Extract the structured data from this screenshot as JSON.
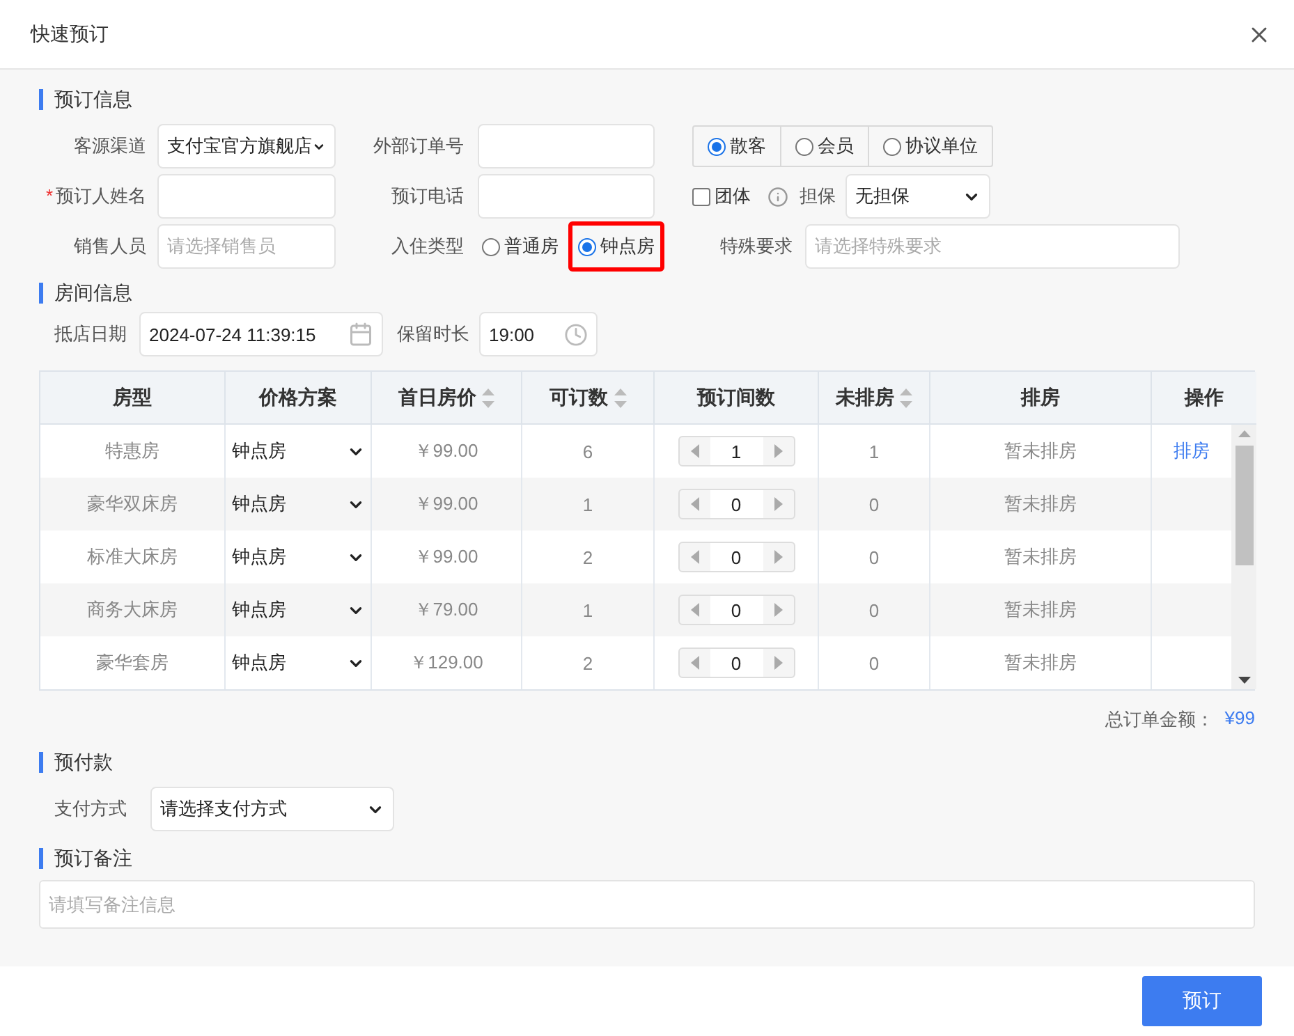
{
  "dialog": {
    "title": "快速预订"
  },
  "booking_info": {
    "title": "预订信息",
    "source_channel": {
      "label": "客源渠道",
      "value": "支付宝官方旗舰店"
    },
    "external_order": {
      "label": "外部订单号"
    },
    "customer_types": [
      {
        "label": "散客",
        "selected": true
      },
      {
        "label": "会员",
        "selected": false
      },
      {
        "label": "协议单位",
        "selected": false
      }
    ],
    "booker_name": {
      "label": "预订人姓名",
      "required_mark": "*"
    },
    "phone": {
      "label": "预订电话"
    },
    "group": {
      "label": "团体",
      "checked": false
    },
    "guarantee": {
      "label": "担保",
      "value": "无担保"
    },
    "sales": {
      "label": "销售人员",
      "placeholder": "请选择销售员"
    },
    "checkin_type": {
      "label": "入住类型",
      "options": [
        {
          "label": "普通房",
          "selected": false,
          "highlighted": false
        },
        {
          "label": "钟点房",
          "selected": true,
          "highlighted": true
        }
      ]
    },
    "special": {
      "label": "特殊要求",
      "placeholder": "请选择特殊要求"
    }
  },
  "room_info": {
    "title": "房间信息",
    "arrival": {
      "label": "抵店日期",
      "value": "2024-07-24 11:39:15"
    },
    "hold": {
      "label": "保留时长",
      "value": "19:00"
    }
  },
  "table": {
    "columns": [
      {
        "label": "房型",
        "sortable": false
      },
      {
        "label": "价格方案",
        "sortable": false
      },
      {
        "label": "首日房价",
        "sortable": true
      },
      {
        "label": "可订数",
        "sortable": true
      },
      {
        "label": "预订间数",
        "sortable": false
      },
      {
        "label": "未排房",
        "sortable": true
      },
      {
        "label": "排房",
        "sortable": false
      },
      {
        "label": "操作",
        "sortable": false
      }
    ],
    "rows": [
      {
        "room_type": "特惠房",
        "plan": "钟点房",
        "price": "￥99.00",
        "available": "6",
        "count": "1",
        "unassigned": "1",
        "assignment": "暂未排房",
        "action": "排房"
      },
      {
        "room_type": "豪华双床房",
        "plan": "钟点房",
        "price": "￥99.00",
        "available": "1",
        "count": "0",
        "unassigned": "0",
        "assignment": "暂未排房"
      },
      {
        "room_type": "标准大床房",
        "plan": "钟点房",
        "price": "￥99.00",
        "available": "2",
        "count": "0",
        "unassigned": "0",
        "assignment": "暂未排房"
      },
      {
        "room_type": "商务大床房",
        "plan": "钟点房",
        "price": "￥79.00",
        "available": "1",
        "count": "0",
        "unassigned": "0",
        "assignment": "暂未排房"
      },
      {
        "room_type": "豪华套房",
        "plan": "钟点房",
        "price": "￥129.00",
        "available": "2",
        "count": "0",
        "unassigned": "0",
        "assignment": "暂未排房"
      }
    ]
  },
  "total": {
    "label": "总订单金额：",
    "value": "¥99"
  },
  "prepay": {
    "title": "预付款",
    "method": {
      "label": "支付方式",
      "value": "请选择支付方式"
    }
  },
  "remarks": {
    "title": "预订备注",
    "placeholder": "请填写备注信息"
  },
  "submit": "预订"
}
